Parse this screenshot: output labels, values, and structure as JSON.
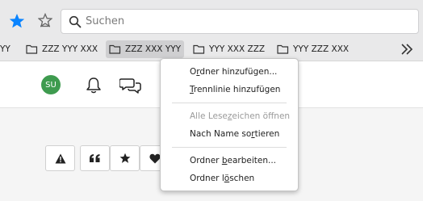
{
  "search": {
    "placeholder": "Suchen"
  },
  "bookmarks": [
    {
      "label": "YY"
    },
    {
      "label": "ZZZ YYY XXX"
    },
    {
      "label": "ZZZ XXX YYY"
    },
    {
      "label": "YYY XXX ZZZ"
    },
    {
      "label": "YYY ZZZ XXX"
    }
  ],
  "page": {
    "avatar_initials": "SU"
  },
  "menu": {
    "add_folder": {
      "pre": "O",
      "u": "r",
      "post": "dner hinzufügen..."
    },
    "add_separator": {
      "pre": "",
      "u": "T",
      "post": "rennlinie hinzufügen"
    },
    "open_all": {
      "pre": "Alle Lese",
      "u": "z",
      "post": "eichen öffnen"
    },
    "sort_by_name": {
      "pre": "Nach Name so",
      "u": "r",
      "post": "tieren"
    },
    "edit_folder": {
      "pre": "Ordner ",
      "u": "b",
      "post": "earbeiten..."
    },
    "delete_folder": {
      "pre": "Ordner l",
      "u": "ö",
      "post": "schen"
    }
  },
  "icons": {
    "bookmark_star": "star-filled-icon",
    "reader": "star-outline-icon",
    "search": "search-icon",
    "folder": "folder-icon",
    "overflow": "chevron-double-right-icon",
    "bell": "bell-icon",
    "chat": "chat-icon",
    "warning": "warning-icon",
    "quote": "quote-icon",
    "star": "star-icon",
    "heart": "heart-icon"
  },
  "colors": {
    "accent_blue": "#0a84ff",
    "avatar_green": "#3e9b4f",
    "active_bookmark": "#cfcfd1"
  }
}
